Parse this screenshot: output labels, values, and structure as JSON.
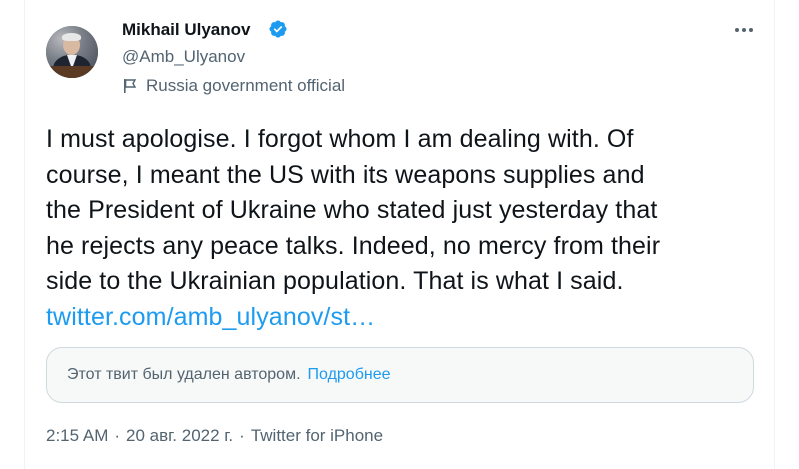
{
  "author": {
    "name": "Mikhail Ulyanov",
    "handle": "@Amb_Ulyanov",
    "label": "Russia government official",
    "verified_color": "#1d9bf0"
  },
  "tweet": {
    "lines": [
      "I must apologise. I forgot whom I am dealing with. Of",
      "course, I meant the US with its weapons supplies and",
      "the President of Ukraine who stated just yesterday that",
      "he rejects any peace talks. Indeed, no mercy from their",
      "side to the Ukrainian population. That is what I said."
    ],
    "link": "twitter.com/amb_ulyanov/st…"
  },
  "quoted": {
    "deleted_text": "Этот твит был удален автором.",
    "learn_more": "Подробнее"
  },
  "meta": {
    "time": "2:15 AM",
    "separator": "·",
    "date": "20 авг. 2022 г.",
    "source": "Twitter for iPhone"
  },
  "icons": {
    "more": "more-horizontal-icon",
    "verified": "verified-badge-icon",
    "label": "flag-icon"
  }
}
